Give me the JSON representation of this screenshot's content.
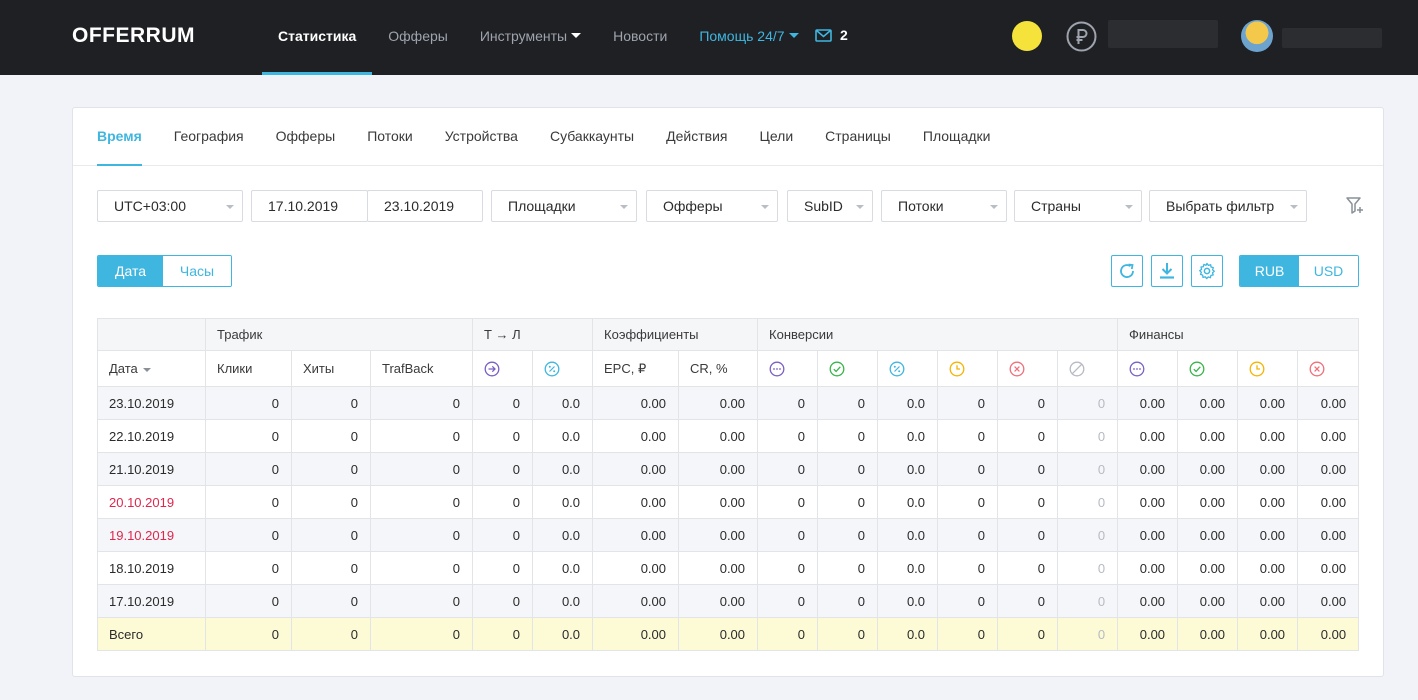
{
  "brand": {
    "logo": "OFFERRUM"
  },
  "nav": {
    "items": [
      "Статистика",
      "Офферы",
      "Инструменты",
      "Новости",
      "Помощь 24/7"
    ],
    "mail_count": "2"
  },
  "tabs": [
    "Время",
    "География",
    "Офферы",
    "Потоки",
    "Устройства",
    "Субаккаунты",
    "Действия",
    "Цели",
    "Страницы",
    "Площадки"
  ],
  "filters": {
    "timezone": "UTC+03:00",
    "date_from": "17.10.2019",
    "date_to": "23.10.2019",
    "platforms": "Площадки",
    "offers": "Офферы",
    "subid": "SubID",
    "streams": "Потоки",
    "countries": "Страны",
    "choose_filter": "Выбрать фильтр"
  },
  "group_toggle": {
    "date": "Дата",
    "hours": "Часы"
  },
  "currency_toggle": {
    "rub": "RUB",
    "usd": "USD"
  },
  "table": {
    "group_headers": {
      "traffic": "Трафик",
      "tl": "Т → Л",
      "coefficients": "Коэффициенты",
      "conversions": "Конверсии",
      "finances": "Финансы"
    },
    "columns": {
      "date": "Дата",
      "clicks": "Клики",
      "hits": "Хиты",
      "trafback": "TrafBack",
      "epc": "EPC, ₽",
      "cr": "CR, %"
    },
    "rows": [
      {
        "date": "23.10.2019",
        "cells": [
          "0",
          "0",
          "0",
          "0",
          "0.0",
          "0.00",
          "0.00",
          "0",
          "0",
          "0.0",
          "0",
          "0",
          "0",
          "0.00",
          "0.00",
          "0.00",
          "0.00"
        ]
      },
      {
        "date": "22.10.2019",
        "cells": [
          "0",
          "0",
          "0",
          "0",
          "0.0",
          "0.00",
          "0.00",
          "0",
          "0",
          "0.0",
          "0",
          "0",
          "0",
          "0.00",
          "0.00",
          "0.00",
          "0.00"
        ]
      },
      {
        "date": "21.10.2019",
        "cells": [
          "0",
          "0",
          "0",
          "0",
          "0.0",
          "0.00",
          "0.00",
          "0",
          "0",
          "0.0",
          "0",
          "0",
          "0",
          "0.00",
          "0.00",
          "0.00",
          "0.00"
        ]
      },
      {
        "date": "20.10.2019",
        "cells": [
          "0",
          "0",
          "0",
          "0",
          "0.0",
          "0.00",
          "0.00",
          "0",
          "0",
          "0.0",
          "0",
          "0",
          "0",
          "0.00",
          "0.00",
          "0.00",
          "0.00"
        ]
      },
      {
        "date": "19.10.2019",
        "cells": [
          "0",
          "0",
          "0",
          "0",
          "0.0",
          "0.00",
          "0.00",
          "0",
          "0",
          "0.0",
          "0",
          "0",
          "0",
          "0.00",
          "0.00",
          "0.00",
          "0.00"
        ]
      },
      {
        "date": "18.10.2019",
        "cells": [
          "0",
          "0",
          "0",
          "0",
          "0.0",
          "0.00",
          "0.00",
          "0",
          "0",
          "0.0",
          "0",
          "0",
          "0",
          "0.00",
          "0.00",
          "0.00",
          "0.00"
        ]
      },
      {
        "date": "17.10.2019",
        "cells": [
          "0",
          "0",
          "0",
          "0",
          "0.0",
          "0.00",
          "0.00",
          "0",
          "0",
          "0.0",
          "0",
          "0",
          "0",
          "0.00",
          "0.00",
          "0.00",
          "0.00"
        ]
      }
    ],
    "total": {
      "label": "Всего",
      "cells": [
        "0",
        "0",
        "0",
        "0",
        "0.0",
        "0.00",
        "0.00",
        "0",
        "0",
        "0.0",
        "0",
        "0",
        "0",
        "0.00",
        "0.00",
        "0.00",
        "0.00"
      ]
    }
  },
  "colors": {
    "accent": "#3fb6e0",
    "weekend_date": "#e0264d",
    "total_row_bg": "#fdfbd6",
    "topbar_bg": "#1f2024",
    "coin": "#f5e33c"
  },
  "icons": {
    "tl_clicks": "arrow-circle-icon",
    "tl_rate": "percent-circle-icon",
    "conv_total": "dots-circle-icon",
    "conv_approved": "check-circle-icon",
    "conv_rate": "percent-circle-icon",
    "conv_pending": "clock-circle-icon",
    "conv_rejected": "cross-circle-icon",
    "conv_trash": "slash-circle-icon"
  }
}
